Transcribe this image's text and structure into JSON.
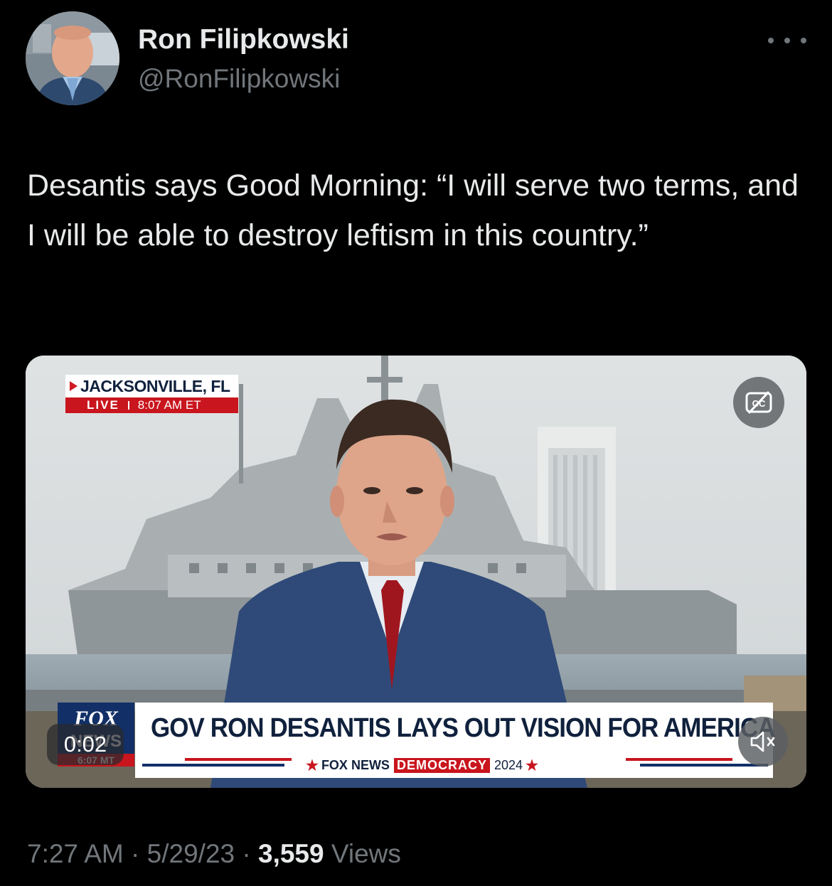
{
  "author": {
    "name": "Ron Filipkowski",
    "handle": "@RonFilipkowski"
  },
  "tweet": {
    "text": "Desantis says Good Morning: “I will serve two terms, and I will be able to destroy leftism in this country.”"
  },
  "video": {
    "location": "JACKSONVILLE, FL",
    "live_label": "LIVE",
    "live_time": "8:07 AM ET",
    "channel_time": "6:07 MT",
    "headline": "GOV RON DESANTIS LAYS OUT VISION FOR AMERICA",
    "sub_brand": "FOX NEWS",
    "sub_tag": "DEMOCRACY",
    "sub_year": "2024",
    "elapsed": "0:02",
    "captions_icon": "captions-off-icon",
    "mute_icon": "speaker-muted-icon"
  },
  "meta": {
    "time": "7:27 AM",
    "date": "5/29/23",
    "separator": "·",
    "views_count": "3,559",
    "views_label": "Views"
  }
}
